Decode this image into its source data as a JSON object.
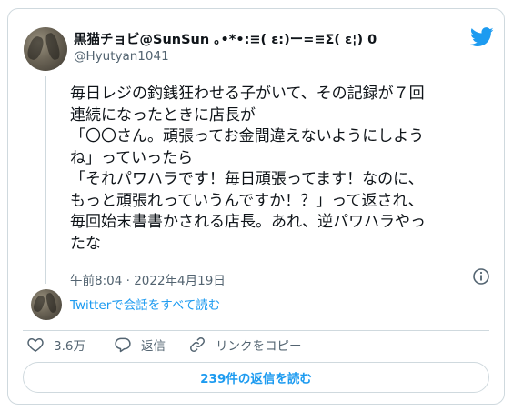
{
  "tweet": {
    "author": {
      "display_name": "黒猫チョビ@SunSun ｡•*•:≡( ε:)ー=≡Σ( ε¦) 0",
      "handle": "@Hyutyan1041"
    },
    "text_lines": [
      "毎日レジの釣銭狂わせる子がいて、その記録が７回",
      "連続になったときに店長が",
      "「〇〇さん。頑張ってお金間違えないようにしよう",
      "ね」っていったら",
      "「それパワハラです！毎日頑張ってます！なのに、",
      "もっと頑張れっていうんですか！？」って返され、",
      "毎回始末書書かされる店長。あれ、逆パワハラやっ",
      "たな"
    ],
    "timestamp": "午前8:04 · 2022年4月19日",
    "thread_link": "Twitterで会話をすべて読む",
    "actions": {
      "like_count": "3.6万",
      "reply_label": "返信",
      "copy_link_label": "リンクをコピー"
    },
    "replies_button": "239件の返信を読む"
  },
  "colors": {
    "brand_blue": "#1d9bf0",
    "like_red": "#f91880",
    "secondary_text": "#536471",
    "border": "#cfd9de"
  },
  "icons": [
    "twitter-bird-icon",
    "info-icon",
    "heart-icon",
    "reply-icon",
    "link-icon"
  ]
}
